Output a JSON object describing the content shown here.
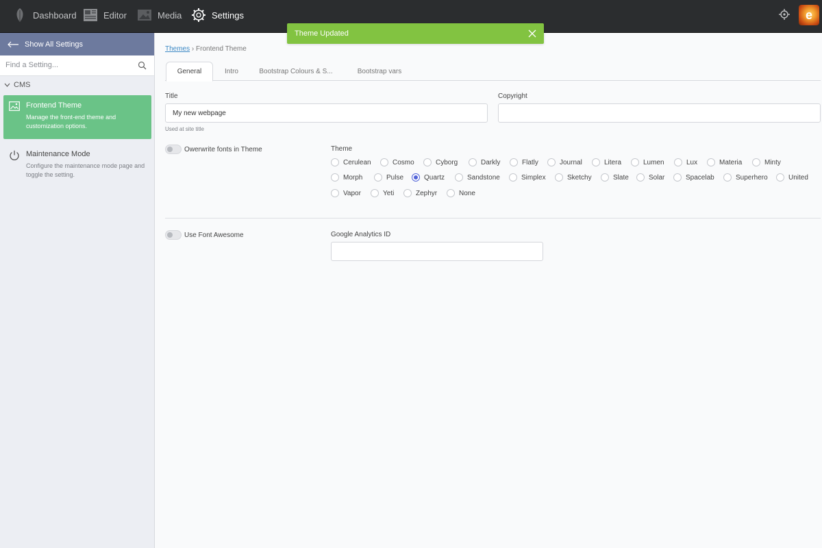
{
  "topbar": {
    "nav": [
      {
        "label": "Dashboard",
        "icon": "feather-icon"
      },
      {
        "label": "Editor",
        "icon": "newspaper-icon"
      },
      {
        "label": "Media",
        "icon": "image-icon"
      },
      {
        "label": "Settings",
        "icon": "gear-icon"
      }
    ],
    "active": "Settings",
    "right_icon": "crosshair-icon",
    "avatar_letter": "e"
  },
  "toast": {
    "message": "Theme Updated",
    "color": "#82c341"
  },
  "sidebar": {
    "back_label": "Show All Settings",
    "search_placeholder": "Find a Setting...",
    "group": "CMS",
    "items": [
      {
        "title": "Frontend Theme",
        "desc": "Manage the front-end theme and customization options.",
        "icon": "image-icon",
        "active": true
      },
      {
        "title": "Maintenance Mode",
        "desc": "Configure the maintenance mode page and toggle the setting.",
        "icon": "power-icon",
        "active": false
      }
    ]
  },
  "breadcrumb": {
    "link": "Themes",
    "separator": "›",
    "current": "Frontend Theme"
  },
  "tabs": [
    "General",
    "Intro",
    "Bootstrap Colours & S...",
    "Bootstrap vars"
  ],
  "active_tab": "General",
  "form": {
    "title_label": "Title",
    "title_value": "My new webpage",
    "title_hint": "Used at site title",
    "copyright_label": "Copyright",
    "copyright_value": "",
    "overwrite_fonts_label": "Owerwrite fonts in Theme",
    "overwrite_fonts_on": false,
    "theme_label": "Theme",
    "themes": [
      [
        "Cerulean",
        "Cosmo",
        "Cyborg",
        "Darkly",
        "Flatly",
        "Journal",
        "Litera",
        "Lumen",
        "Lux",
        "Materia",
        "Minty"
      ],
      [
        "Morph",
        "Pulse",
        "Quartz",
        "Sandstone",
        "Simplex",
        "Sketchy",
        "Slate",
        "Solar",
        "Spacelab",
        "Superhero",
        "United"
      ],
      [
        "Vapor",
        "Yeti",
        "Zephyr",
        "None"
      ]
    ],
    "selected_theme": "Quartz",
    "font_awesome_label": "Use Font Awesome",
    "font_awesome_on": false,
    "ga_label": "Google Analytics ID",
    "ga_value": ""
  },
  "colors": {
    "sidebar_header": "#6d7a9e",
    "active_item": "#6ac387",
    "radio_accent": "#5163d8",
    "topbar": "#2b2d2f"
  }
}
